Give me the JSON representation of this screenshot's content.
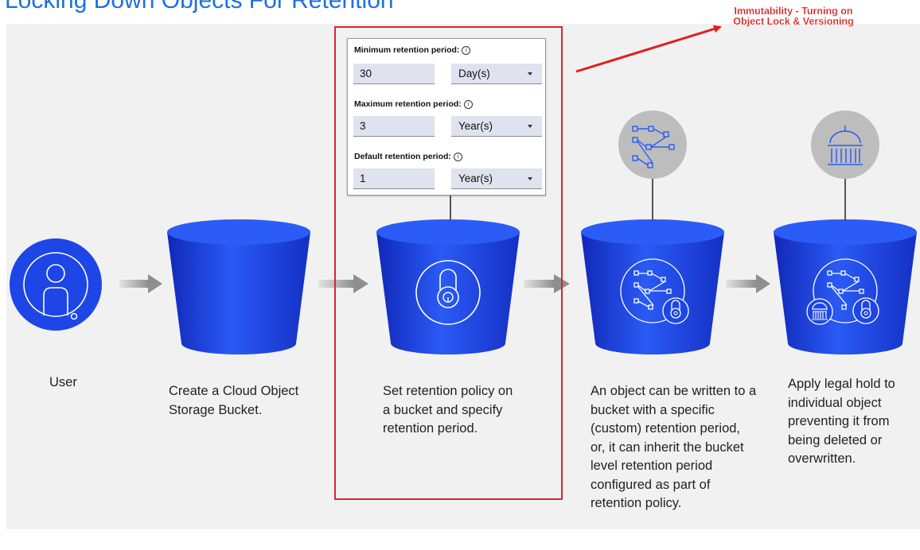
{
  "title": "Locking Down Objects For Retention",
  "annotation": {
    "line1": "Immutability - Turning on",
    "line2": "Object Lock & Versioning",
    "color": "#e21a1a"
  },
  "form": {
    "min_label": "Minimum retention period:",
    "min_value": "30",
    "min_unit": "Day(s)",
    "max_label": "Maximum retention period:",
    "max_value": "3",
    "max_unit": "Year(s)",
    "default_label": "Default retention period:",
    "default_value": "1",
    "default_unit": "Year(s)",
    "info_glyph": "i"
  },
  "steps": [
    {
      "caption": "User",
      "icon": "user-icon"
    },
    {
      "caption": "Create a Cloud Object Storage Bucket.",
      "icon": "bucket-icon"
    },
    {
      "caption": "Set retention policy on a bucket and specify retention period.",
      "icon": "lock-icon"
    },
    {
      "caption": "An object can be written to a bucket with a specific (custom) retention period, or, it can inherit the bucket level retention period configured as part of retention policy.",
      "icon": "object-network-icon"
    },
    {
      "caption": "Apply legal hold to individual object preventing it from being deleted or overwritten.",
      "icon": "legal-hold-icon"
    }
  ],
  "colors": {
    "accent": "#1f6fe0",
    "bucket": "#1a3fe0",
    "highlight_box": "#d9262c",
    "panel": "#f1f1f1"
  }
}
